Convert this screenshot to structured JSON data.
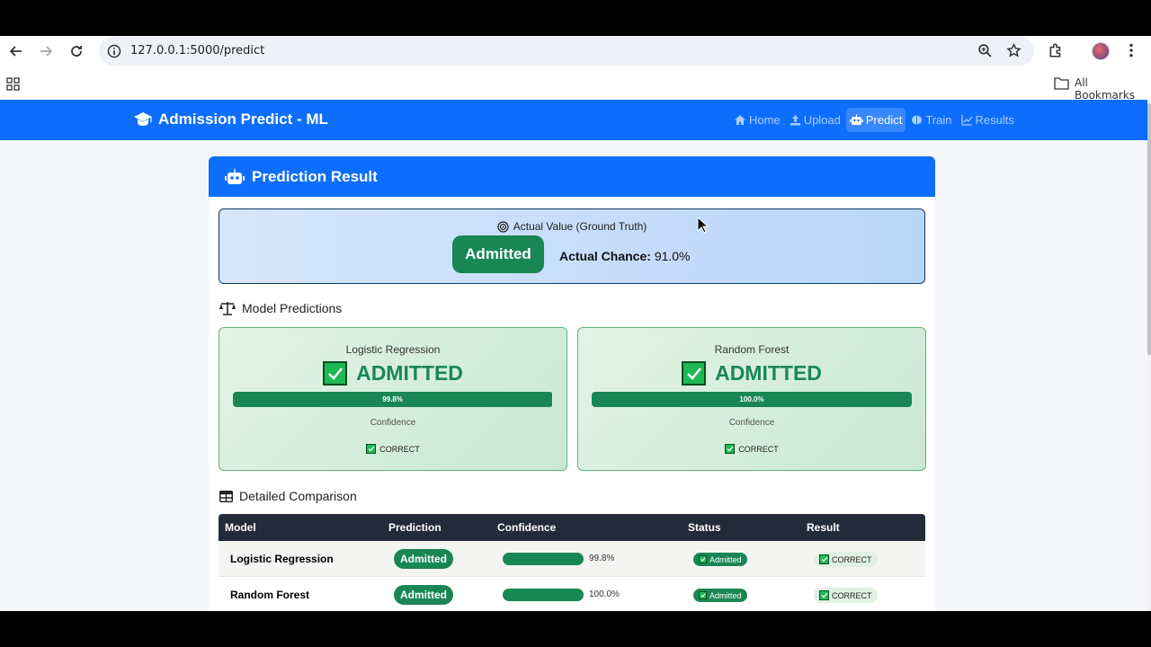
{
  "browser": {
    "url": "127.0.0.1:5000/predict",
    "bookmarks_label": "All Bookmarks"
  },
  "navbar": {
    "brand": "Admission Predict - ML",
    "links": [
      "Home",
      "Upload",
      "Predict",
      "Train",
      "Results"
    ],
    "active": "Predict"
  },
  "card": {
    "title": "Prediction Result",
    "actual": {
      "title": "Actual Value (Ground Truth)",
      "status": "Admitted",
      "chance_label": "Actual Chance:",
      "chance_value": "91.0%"
    },
    "predictions_title": "Model Predictions",
    "predictions": [
      {
        "model": "Logistic Regression",
        "result": "ADMITTED",
        "confidence": 0.998,
        "confidence_text": "99.8%",
        "confidence_label": "Confidence",
        "verdict": "CORRECT"
      },
      {
        "model": "Random Forest",
        "result": "ADMITTED",
        "confidence": 1.0,
        "confidence_text": "100.0%",
        "confidence_label": "Confidence",
        "verdict": "CORRECT"
      }
    ],
    "comparison_title": "Detailed Comparison",
    "table": {
      "headers": [
        "Model",
        "Prediction",
        "Confidence",
        "Status",
        "Result"
      ],
      "rows": [
        {
          "model": "Logistic Regression",
          "prediction": "Admitted",
          "confidence": 0.998,
          "confidence_text": "99.8%",
          "status": "Admitted",
          "result": "CORRECT"
        },
        {
          "model": "Random Forest",
          "prediction": "Admitted",
          "confidence": 1.0,
          "confidence_text": "100.0%",
          "status": "Admitted",
          "result": "CORRECT"
        }
      ]
    }
  },
  "colors": {
    "primary": "#0d6efd",
    "success": "#198754",
    "table_header": "#212b3a"
  }
}
